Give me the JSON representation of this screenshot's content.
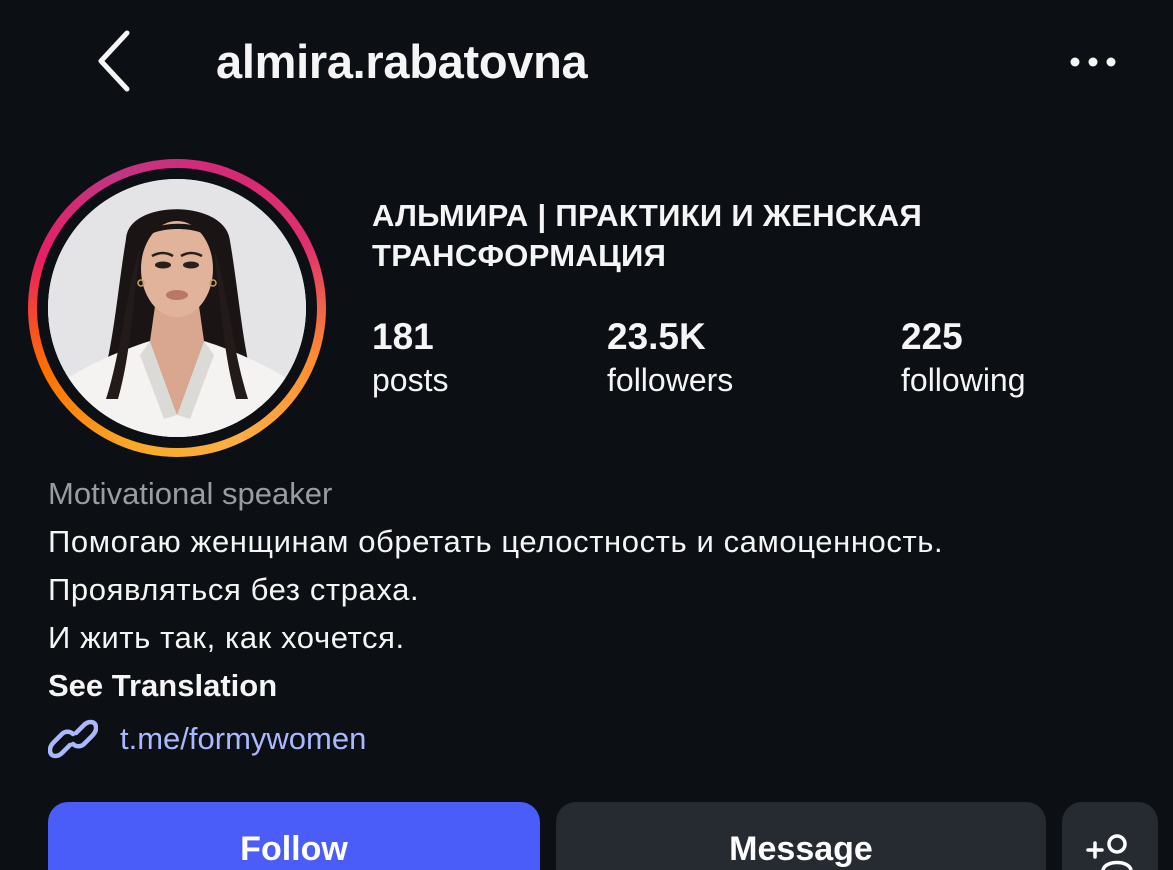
{
  "header": {
    "back_icon": "chevron-left-icon",
    "username": "almira.rabatovna",
    "more_icon": "more-horizontal-icon"
  },
  "profile": {
    "avatar_icon": "profile-photo",
    "display_name": "АЛЬМИРА | ПРАКТИКИ И ЖЕНСКАЯ ТРАНСФОРМАЦИЯ",
    "stats": [
      {
        "value": "181",
        "label": "posts"
      },
      {
        "value": "23.5K",
        "label": "followers"
      },
      {
        "value": "225",
        "label": "following"
      }
    ]
  },
  "bio": {
    "category": "Motivational speaker",
    "lines": [
      "Помогаю женщинам обретать целостность и самоценность.",
      "Проявляться без страха.",
      "И жить так, как хочется."
    ],
    "see_translation": "See Translation",
    "link_icon": "link-icon",
    "link": "t.me/formywomen"
  },
  "actions": {
    "follow": "Follow",
    "message": "Message",
    "suggest_icon": "add-person-icon"
  },
  "colors": {
    "background": "#0c0f14",
    "follow_button": "#4a5df9",
    "secondary_button": "#262a31",
    "link": "#a9b8ff",
    "muted_text": "#9a9ca3"
  }
}
